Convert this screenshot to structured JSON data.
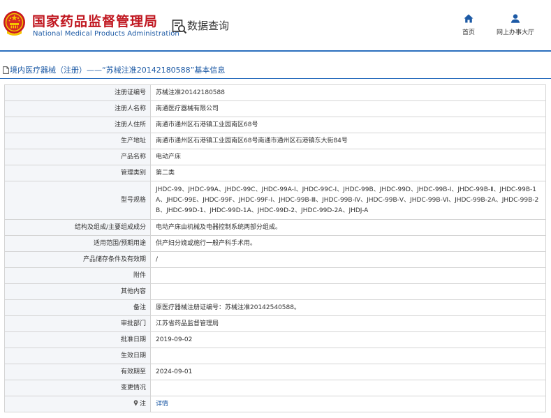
{
  "header": {
    "org_name_cn": "国家药品监督管理局",
    "org_name_en": "National Medical Products Administration",
    "section_title": "数据查询",
    "colors": {
      "brand_red": "#c0161f",
      "brand_blue": "#1d5aa5",
      "rule_blue": "#2a6ebd"
    }
  },
  "nav": {
    "home_label": "首页",
    "hall_label": "网上办事大厅"
  },
  "breadcrumb": {
    "text": "境内医疗器械（注册）——“苏械注准20142180588”基本信息"
  },
  "record": {
    "reg_no_label": "注册证编号",
    "reg_no": "苏械注准20142180588",
    "registrant_label": "注册人名称",
    "registrant": "南通医疗器械有限公司",
    "residence_label": "注册人住所",
    "residence": "南通市通州区石港镇工业园南区68号",
    "production_label": "生产地址",
    "production": "南通市通州区石港镇工业园南区68号南通市通州区石港镇东大街84号",
    "product_label": "产品名称",
    "product": "电动产床",
    "category_label": "管理类别",
    "category": "第二类",
    "models_label": "型号规格",
    "models": "JHDC-99、JHDC-99A、JHDC-99C、JHDC-99A-Ⅰ、JHDC-99C-Ⅰ、JHDC-99B、JHDC-99D、JHDC-99B-Ⅰ、JHDC-99B-Ⅱ、JHDC-99B-1A、JHDC-99E、JHDC-99F、JHDC-99F-Ⅰ、JHDC-99B-Ⅲ、JHDC-99B-Ⅳ、JHDC-99B-Ⅴ、JHDC-99B-Ⅵ、JHDC-99B-2A、JHDC-99B-2B、JHDC-99D-1、JHDC-99D-1A、JHDC-99D-2、JHDC-99D-2A、JHDJ-A",
    "structure_label": "结构及组成/主要组成成分",
    "structure": "电动产床由机械及电器控制系统两部分组成。",
    "scope_label": "适用范围/预期用途",
    "scope": "供产妇分娩或施行一般产科手术用。",
    "storage_label": "产品储存条件及有效期",
    "storage": "/",
    "attachment_label": "附件",
    "attachment": "",
    "other_label": "其他内容",
    "other": "",
    "remarks_label": "备注",
    "remarks": "原医疗器械注册证编号：苏械注准20142540588。",
    "dept_label": "审批部门",
    "dept": "江苏省药品监督管理局",
    "approval_date_label": "批准日期",
    "approval_date": "2019-09-02",
    "effective_date_label": "生效日期",
    "effective_date": "",
    "valid_until_label": "有效期至",
    "valid_until": "2024-09-01",
    "changes_label": "变更情况",
    "changes": "",
    "note_label": "注",
    "note_link": "详情"
  },
  "icons": {
    "emblem": "national-emblem-icon",
    "query": "data-query-icon",
    "home": "home-icon",
    "hall": "user-icon",
    "breadcrumb": "document-icon",
    "note": "pin-icon"
  }
}
